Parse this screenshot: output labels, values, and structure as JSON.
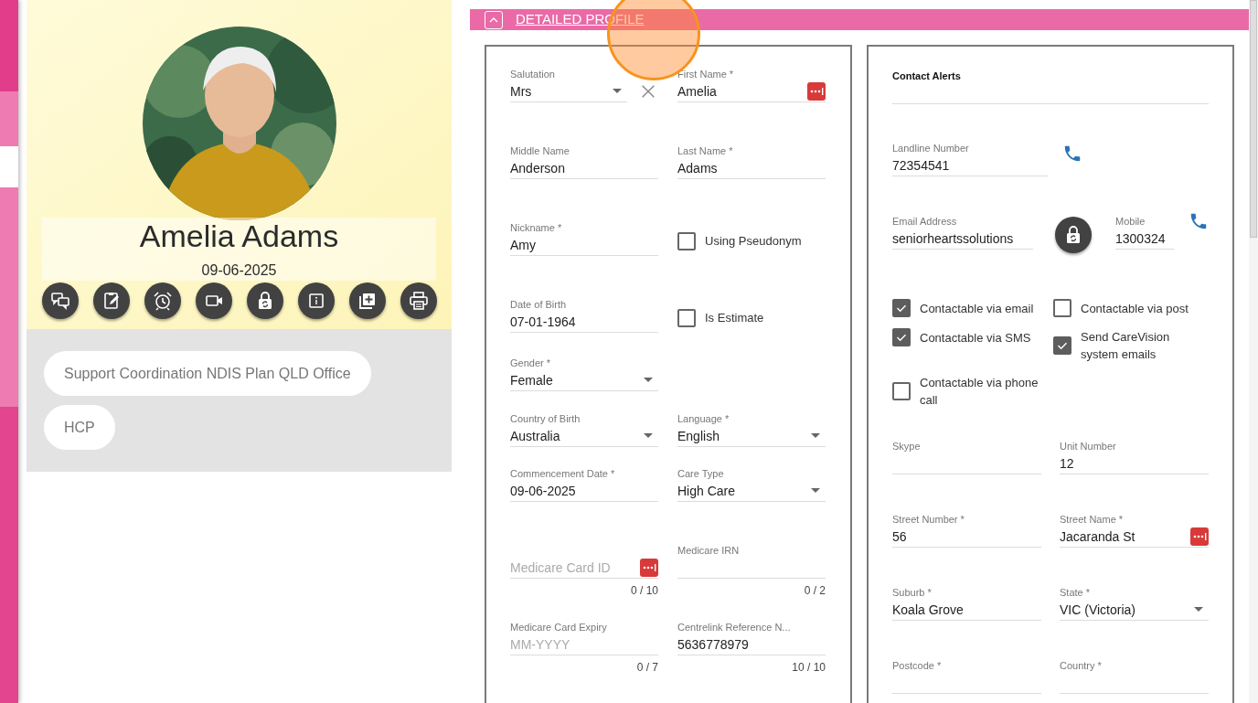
{
  "profile": {
    "name": "Amelia Adams",
    "date": "09-06-2025",
    "tags": [
      "Support Coordination NDIS Plan QLD Office",
      "HCP"
    ]
  },
  "section": {
    "title": "DETAILED PROFILE",
    "expanded": true
  },
  "personal": {
    "rows": [
      [
        {
          "kind": "select",
          "label": "Salutation",
          "value": "Mrs",
          "clear": true
        },
        {
          "kind": "text",
          "label": "First Name *",
          "value": "Amelia",
          "mask": true
        }
      ],
      [
        {
          "kind": "text",
          "label": "Middle Name",
          "value": "Anderson"
        },
        {
          "kind": "text",
          "label": "Last Name *",
          "value": "Adams"
        }
      ],
      [
        {
          "kind": "text",
          "label": "Nickname *",
          "value": "Amy"
        },
        {
          "kind": "checkbox",
          "label": "Using Pseudonym",
          "checked": false
        }
      ],
      [
        {
          "kind": "text",
          "label": "Date of Birth",
          "value": "07-01-1964"
        },
        {
          "kind": "checkbox",
          "label": "Is Estimate",
          "checked": false
        }
      ],
      [
        {
          "kind": "select",
          "label": "Gender *",
          "value": "Female"
        }
      ],
      [
        {
          "kind": "select",
          "label": "Country of Birth",
          "value": "Australia"
        },
        {
          "kind": "select",
          "label": "Language *",
          "value": "English"
        }
      ],
      [
        {
          "kind": "text",
          "label": "Commencement Date *",
          "value": "09-06-2025"
        },
        {
          "kind": "select",
          "label": "Care Type",
          "value": "High Care"
        }
      ],
      [
        {
          "kind": "text",
          "placeholder": "Medicare Card ID",
          "mask": true,
          "counter": "0 / 10"
        },
        {
          "kind": "text",
          "label": "Medicare IRN",
          "counter": "0 / 2"
        }
      ],
      [
        {
          "kind": "text",
          "label": "Medicare Card Expiry",
          "placeholder": "MM-YYYY",
          "counter": "0 / 7"
        },
        {
          "kind": "text",
          "label": "Centrelink Reference N...",
          "value": "5636778979",
          "counter": "10 / 10"
        }
      ]
    ]
  },
  "contact": {
    "alerts_label": "Contact Alerts",
    "landline": {
      "label": "Landline Number",
      "value": "72354541"
    },
    "email": {
      "label": "Email Address",
      "value": "seniorheartssolutions"
    },
    "mobile": {
      "label": "Mobile",
      "value": "1300324"
    },
    "options": [
      {
        "label": "Contactable via email",
        "checked": true
      },
      {
        "label": "Contactable via post",
        "checked": false
      },
      {
        "label": "Contactable via SMS",
        "checked": true
      },
      {
        "label": "Send CareVision system emails",
        "checked": true
      },
      {
        "label": "Contactable via phone call",
        "checked": false
      }
    ],
    "rows": [
      [
        {
          "kind": "text",
          "label": "Skype"
        },
        {
          "kind": "text",
          "label": "Unit Number",
          "value": "12"
        }
      ],
      [
        {
          "kind": "text",
          "label": "Street Number *",
          "value": "56"
        },
        {
          "kind": "text",
          "label": "Street Name *",
          "value": "Jacaranda St",
          "mask": true
        }
      ],
      [
        {
          "kind": "text",
          "label": "Suburb *",
          "value": "Koala Grove"
        },
        {
          "kind": "select",
          "label": "State *",
          "value": "VIC (Victoria)"
        }
      ],
      [
        {
          "kind": "text",
          "label": "Postcode *"
        },
        {
          "kind": "text",
          "label": "Country *"
        }
      ]
    ]
  }
}
